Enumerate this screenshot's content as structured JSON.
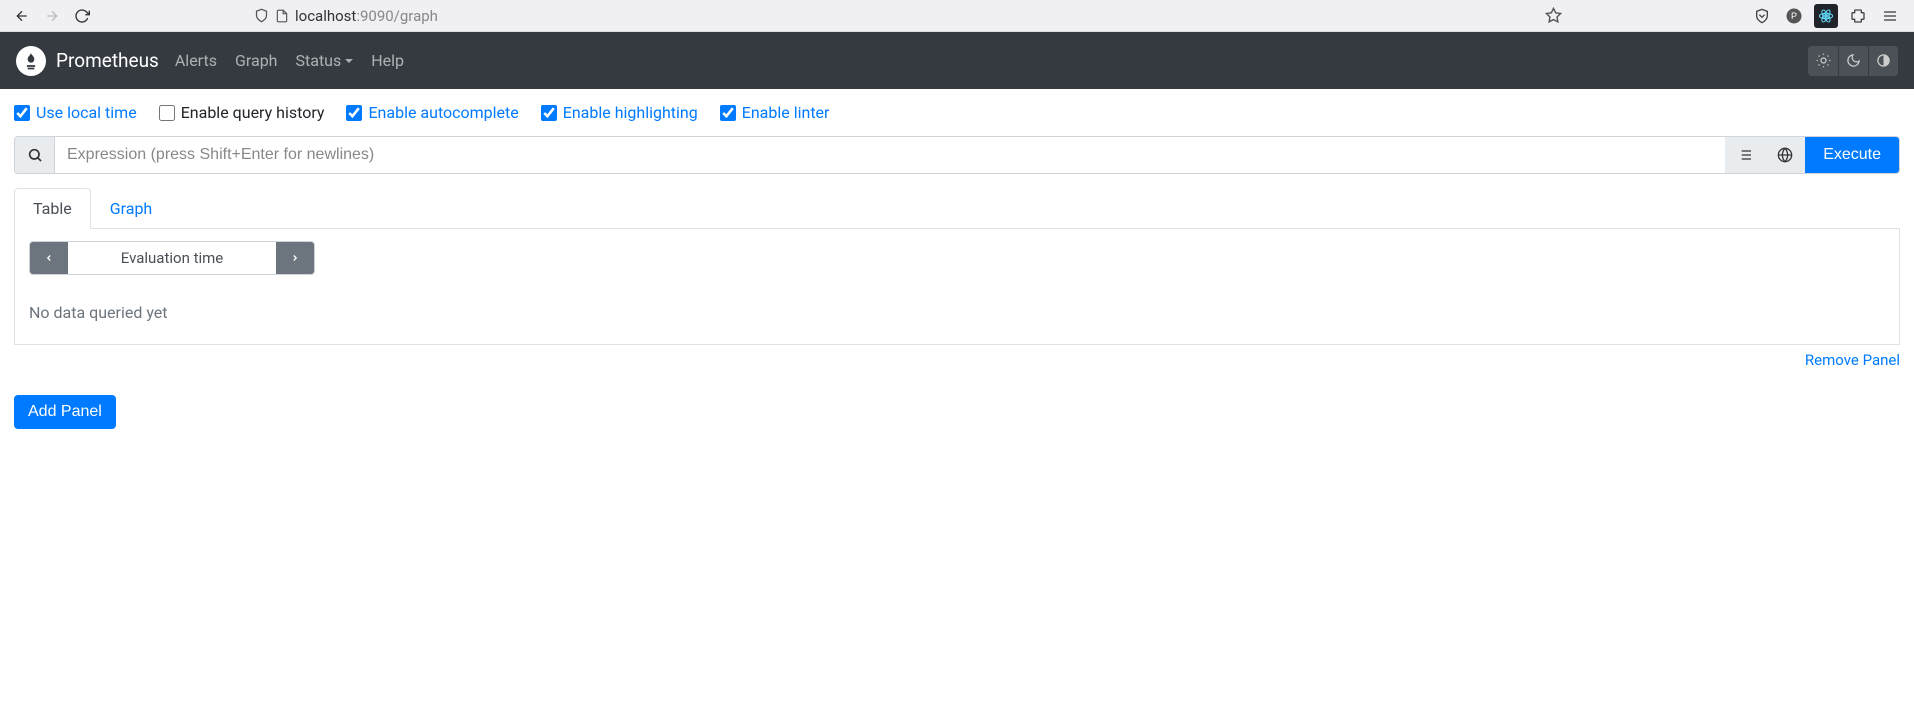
{
  "browser": {
    "host": "localhost",
    "port_path": ":9090/graph"
  },
  "navbar": {
    "brand": "Prometheus",
    "links": {
      "alerts": "Alerts",
      "graph": "Graph",
      "status": "Status",
      "help": "Help"
    }
  },
  "options": {
    "use_local_time": {
      "label": "Use local time",
      "checked": true
    },
    "query_history": {
      "label": "Enable query history",
      "checked": false
    },
    "autocomplete": {
      "label": "Enable autocomplete",
      "checked": true
    },
    "highlighting": {
      "label": "Enable highlighting",
      "checked": true
    },
    "linter": {
      "label": "Enable linter",
      "checked": true
    }
  },
  "expression": {
    "placeholder": "Expression (press Shift+Enter for newlines)",
    "value": "",
    "execute_label": "Execute"
  },
  "tabs": {
    "table": "Table",
    "graph": "Graph"
  },
  "panel": {
    "eval_label": "Evaluation time",
    "no_data": "No data queried yet",
    "remove_label": "Remove Panel"
  },
  "add_panel_label": "Add Panel"
}
